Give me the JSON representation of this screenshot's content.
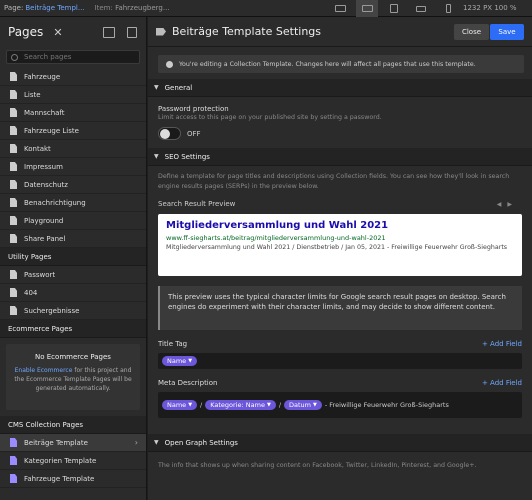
{
  "topbar": {
    "page_label": "Page:",
    "page_value": "Beiträge Templ...",
    "item_label": "Item:",
    "item_value": "Fahrzeugberg...",
    "width": "1232",
    "unit": "PX",
    "zoom": "100 %"
  },
  "left": {
    "title": "Pages",
    "search_placeholder": "Search pages",
    "pages": [
      "Fahrzeuge",
      "Liste",
      "Mannschaft",
      "Fahrzeuge Liste",
      "Kontakt",
      "Impressum",
      "Datenschutz",
      "Benachrichtigung",
      "Playground",
      "Share Panel"
    ],
    "utility_header": "Utility Pages",
    "utility": [
      "Passwort",
      "404",
      "Suchergebnisse"
    ],
    "ecommerce_header": "Ecommerce Pages",
    "ecommerce_title": "No Ecommerce Pages",
    "ecommerce_link": "Enable Ecommerce",
    "ecommerce_desc": "for this project and the Ecommerce Template Pages will be generated automatically.",
    "cms_header": "CMS Collection Pages",
    "cms": [
      "Beiträge Template",
      "Kategorien Template",
      "Fahrzeuge Template"
    ]
  },
  "right": {
    "title": "Beiträge Template Settings",
    "close": "Close",
    "save": "Save",
    "notice": "You're editing a Collection Template. Changes here will affect all pages that use this template.",
    "general": "General",
    "pw_label": "Password protection",
    "pw_desc": "Limit access to this page on your published site by setting a password.",
    "pw_state": "OFF",
    "seo": "SEO Settings",
    "seo_desc": "Define a template for page titles and descriptions using Collection fields. You can see how they'll look in search engine results pages (SERPs) in the preview below.",
    "preview_label": "Search Result Preview",
    "serp_title": "Mitgliederversammlung und Wahl 2021",
    "serp_url": "www.ff-siegharts.at/beitrag/mitgliederversammlung-und-wahl-2021",
    "serp_desc": "Mitgliederversammlung und Wahl 2021 / Dienstbetrieb / Jan 05, 2021 - Freiwillige Feuerwehr Groß-Siegharts",
    "info": "This preview uses the typical character limits for Google search result pages on desktop. Search engines do experiment with their character limits, and may decide to show different content.",
    "title_tag_label": "Title Tag",
    "add_field": "+ Add Field",
    "title_pill": "Name",
    "meta_label": "Meta Description",
    "meta_pills": [
      "Name",
      "Kategorie: Name",
      "Datum"
    ],
    "sep": "/",
    "meta_suffix": "- Freiwillige Feuerwehr Groß-Siegharts",
    "og": "Open Graph Settings",
    "og_desc": "The info that shows up when sharing content on Facebook, Twitter, LinkedIn, Pinterest, and Google+."
  }
}
